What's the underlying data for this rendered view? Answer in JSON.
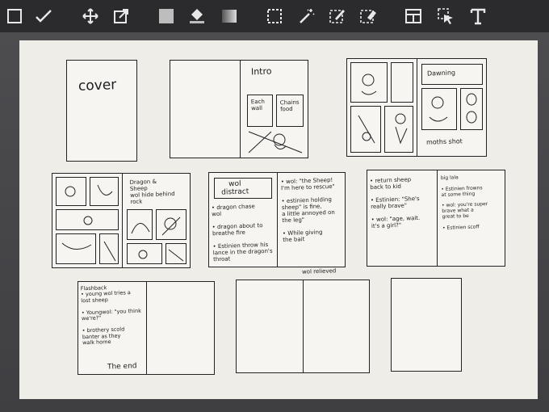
{
  "toolbar": {
    "tools": [
      "select-rect-icon",
      "brush-icon",
      "move-icon",
      "transform-icon",
      "fill-color-icon",
      "bucket-fill-icon",
      "gradient-icon",
      "marquee-select-icon",
      "magic-wand-icon",
      "select-pen-icon",
      "select-eraser-icon",
      "layout-panel-icon",
      "pointer-select-icon",
      "text-tool-icon"
    ]
  },
  "spreads": {
    "cover": {
      "label": "cover"
    },
    "intro": {
      "label": "Intro",
      "box1": "Each\nwall",
      "box2": "Chains\nfood"
    },
    "dawning": {
      "label": "Dawning",
      "note": "moths  shot"
    },
    "dragon": {
      "note": "Dragon &\nSheep\nwol hide behind\nrock"
    },
    "distract": {
      "box": "wol\ndistract",
      "left_notes": "• dragon chase\n  wol\n\n• dragon about to\n  breathe fire\n\n• Estinien throw his\n  lance in the dragon's\n  throat",
      "right_notes": "• wol: \"the Sheep!\n  I'm here to rescue\"\n\n• estinien holding\n  sheep\" is fine,\n  a little annoyed on\n  the leg\"\n\n• While giving\n  the bait",
      "bottom": "wol relieved"
    },
    "return": {
      "left_notes": "• return sheep\n  back to kid\n\n• Estinien: \"She's\n  really brave\"\n\n• wol: \"age, wait.\n  it's a girl?\"",
      "right_notes": "big lala\n\n• Estinien frowns\n  at some thing\n\n• wol: you're super\n  brave what a\n  great to be\n\n• Estinien scoff"
    },
    "flashback": {
      "notes": "Flashback\n• young wol tries a\n  lost sheep\n\n• Youngwol: \"you think\n  we're?\"\n\n• brothery scold\n  banter as they\n  walk home",
      "end": "The end"
    }
  }
}
